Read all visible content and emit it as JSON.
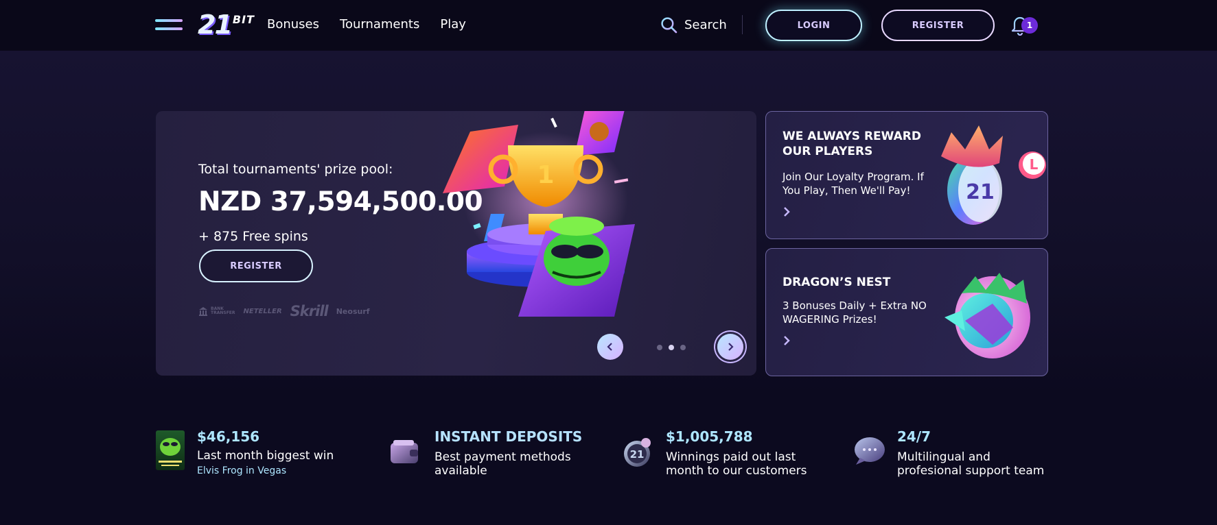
{
  "header": {
    "logo_number": "21",
    "logo_suffix": "BIT",
    "nav": [
      "Bonuses",
      "Tournaments",
      "Play"
    ],
    "search_label": "Search",
    "login_label": "LOGIN",
    "register_label": "REGISTER",
    "notification_count": "1"
  },
  "hero": {
    "pre_title": "Total tournaments' prize pool:",
    "amount": "NZD 37,594,500.00",
    "free_spins": "+ 875 Free spins",
    "register_label": "REGISTER",
    "payment_logos": {
      "bank_line1": "BANK",
      "bank_line2": "TRANSFER",
      "neteller": "NETELLER",
      "skrill": "Skrill",
      "neosurf": "Neosurf"
    },
    "slides_total": 3,
    "active_slide": 2
  },
  "cards": [
    {
      "title": "WE ALWAYS REWARD OUR PLAYERS",
      "text": "Join Our Loyalty Program. If You Play, Then We'll Pay!",
      "coin_label": "21"
    },
    {
      "title": "DRAGON’S NEST",
      "text": "3 Bonuses Daily + Extra NO WAGERING Prizes!"
    }
  ],
  "stats": [
    {
      "heading": "$46,156",
      "description": "Last month biggest win",
      "sub": "Elvis Frog in Vegas"
    },
    {
      "heading": "INSTANT DEPOSITS",
      "description": "Best payment methods available"
    },
    {
      "heading": "$1,005,788",
      "description": "Winnings paid out last month to our customers"
    },
    {
      "heading": "24/7",
      "description": "Multilingual and profesional support team"
    }
  ],
  "colors": {
    "background": "#0c0a1f",
    "header": "#0a0819",
    "accent_cyan": "#aee6ff",
    "accent_purple": "#6d2bd9",
    "button_text": "#d9ccff"
  }
}
